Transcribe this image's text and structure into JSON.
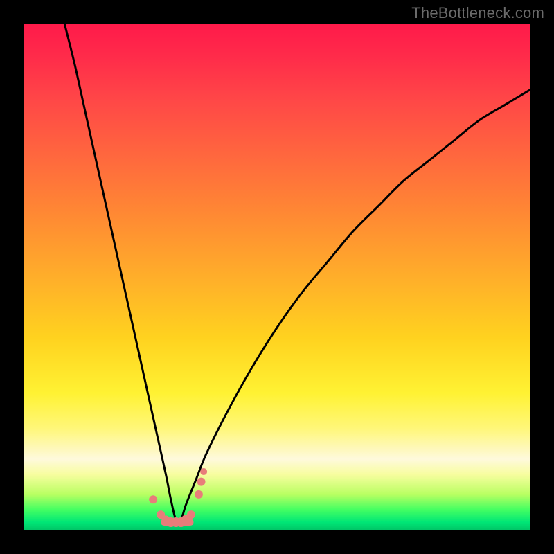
{
  "watermark": {
    "text": "TheBottleneck.com"
  },
  "colors": {
    "frame": "#000000",
    "curve_stroke": "#000000",
    "marker_fill": "#e87d7a",
    "marker_stroke": "#e87d7a"
  },
  "chart_data": {
    "type": "line",
    "title": "",
    "xlabel": "",
    "ylabel": "",
    "xlim": [
      0,
      100
    ],
    "ylim": [
      0,
      100
    ],
    "note": "Axes are unlabeled; both curve and markers are estimated from pixel positions on the plot. y=0 is the bottom (green) edge, y=100 is the top (red) edge.",
    "series": [
      {
        "name": "bottleneck-curve",
        "description": "V-shaped curve; steep left branch, shallower right branch; minimum near the bottom at x≈30",
        "x": [
          8,
          10,
          12,
          14,
          16,
          18,
          20,
          22,
          24,
          26,
          28,
          29,
          30,
          31,
          32,
          34,
          36,
          40,
          45,
          50,
          55,
          60,
          65,
          70,
          75,
          80,
          85,
          90,
          95,
          100
        ],
        "y": [
          100,
          92,
          83,
          74,
          65,
          56,
          47,
          38,
          29,
          20,
          11,
          6,
          2,
          2,
          5,
          10,
          15,
          23,
          32,
          40,
          47,
          53,
          59,
          64,
          69,
          73,
          77,
          81,
          84,
          87
        ]
      }
    ],
    "markers": {
      "name": "highlight-points",
      "description": "Salmon dots and short bar segments clustered near the curve minimum (in the green band).",
      "points": [
        {
          "x": 25.5,
          "y": 6.0,
          "r": 6
        },
        {
          "x": 27.0,
          "y": 3.0,
          "r": 6
        },
        {
          "x": 28.0,
          "y": 2.0,
          "r": 6
        },
        {
          "x": 29.0,
          "y": 1.5,
          "r": 7
        },
        {
          "x": 30.0,
          "y": 1.5,
          "r": 7
        },
        {
          "x": 31.0,
          "y": 1.5,
          "r": 7
        },
        {
          "x": 32.0,
          "y": 2.0,
          "r": 7
        },
        {
          "x": 33.0,
          "y": 3.0,
          "r": 6
        },
        {
          "x": 34.5,
          "y": 7.0,
          "r": 6
        },
        {
          "x": 35.0,
          "y": 9.5,
          "r": 6
        },
        {
          "x": 35.5,
          "y": 11.5,
          "r": 5
        }
      ],
      "bar": {
        "x0": 27.0,
        "x1": 33.5,
        "y": 1.5,
        "thickness": 10
      }
    }
  }
}
